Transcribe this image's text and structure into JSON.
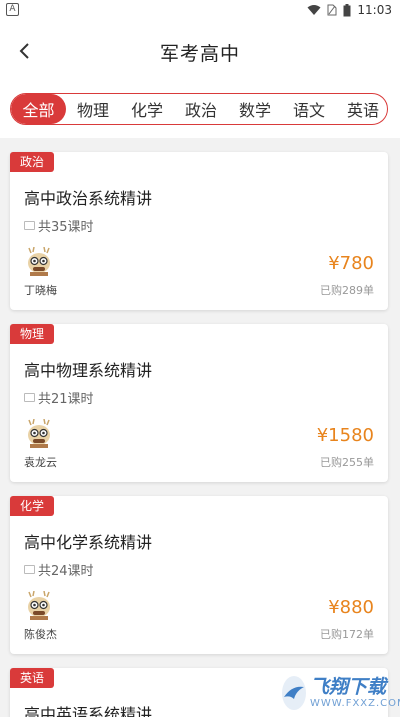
{
  "status_bar": {
    "time": "11:03",
    "app_badge": "A"
  },
  "header": {
    "title": "军考高中"
  },
  "tabs": [
    {
      "label": "全部",
      "active": true
    },
    {
      "label": "物理",
      "active": false
    },
    {
      "label": "化学",
      "active": false
    },
    {
      "label": "政治",
      "active": false
    },
    {
      "label": "数学",
      "active": false
    },
    {
      "label": "语文",
      "active": false
    },
    {
      "label": "英语",
      "active": false
    }
  ],
  "courses": [
    {
      "tag": "政治",
      "title": "高中政治系统精讲",
      "lessons": "共35课时",
      "teacher": "丁晓梅",
      "price": "¥780",
      "sold": "已购289单"
    },
    {
      "tag": "物理",
      "title": "高中物理系统精讲",
      "lessons": "共21课时",
      "teacher": "袁龙云",
      "price": "¥1580",
      "sold": "已购255单"
    },
    {
      "tag": "化学",
      "title": "高中化学系统精讲",
      "lessons": "共24课时",
      "teacher": "陈俊杰",
      "price": "¥880",
      "sold": "已购172单"
    },
    {
      "tag": "英语",
      "title": "高中英语系统精讲"
    }
  ],
  "watermark": {
    "main": "飞翔下载",
    "sub": "WWW.FXXZ.COM"
  },
  "colors": {
    "accent": "#d93a3a",
    "price": "#e8841d",
    "background": "#f2f2f2"
  }
}
